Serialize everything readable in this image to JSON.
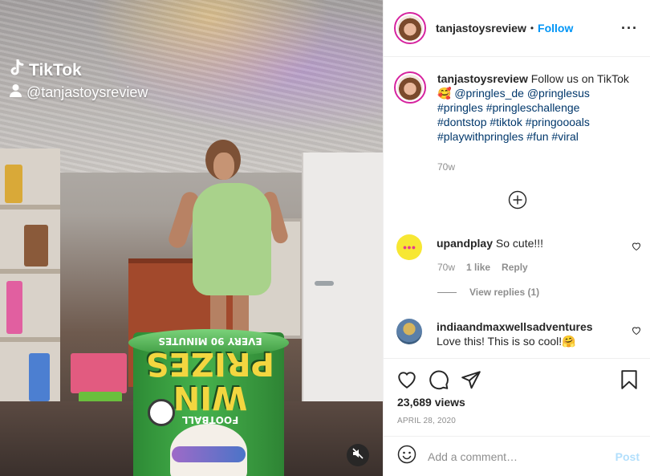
{
  "media": {
    "watermark_brand": "TikTok",
    "watermark_handle": "@tanjastoysreview",
    "can_text_main": "WIN PRIZES",
    "can_text_football": "FOOTBALL",
    "can_text_small": "EVERY 90 MINUTES"
  },
  "header": {
    "username": "tanjastoysreview",
    "dot": "•",
    "follow_label": "Follow",
    "more_icon": "more-horizontal-icon"
  },
  "caption": {
    "username": "tanjastoysreview",
    "intro": "Follow us on TikTok",
    "emoji": "🥰",
    "mentions": [
      "@pringles_de",
      "@pringlesus"
    ],
    "hashtags_line1": "#pringles #pringleschallenge",
    "hashtags_line2": "#dontstop #tiktok #pringoooals",
    "hashtags_line3": "#playwithpringles #fun #viral",
    "time": "70w"
  },
  "comments": [
    {
      "username": "upandplay",
      "text": "So cute!!!",
      "time": "70w",
      "likes": "1 like",
      "reply_label": "Reply",
      "view_replies": "View replies (1)"
    },
    {
      "username": "indiaandmaxwellsadventures",
      "text": "Love this! This is so cool!🤗"
    }
  ],
  "stats": {
    "views": "23,689 views",
    "date": "APRIL 28, 2020"
  },
  "add_comment": {
    "placeholder": "Add a comment…",
    "post_label": "Post"
  },
  "colors": {
    "accent": "#0095f6",
    "post_disabled": "#b2dffc",
    "secondary_text": "#8e8e8e"
  }
}
